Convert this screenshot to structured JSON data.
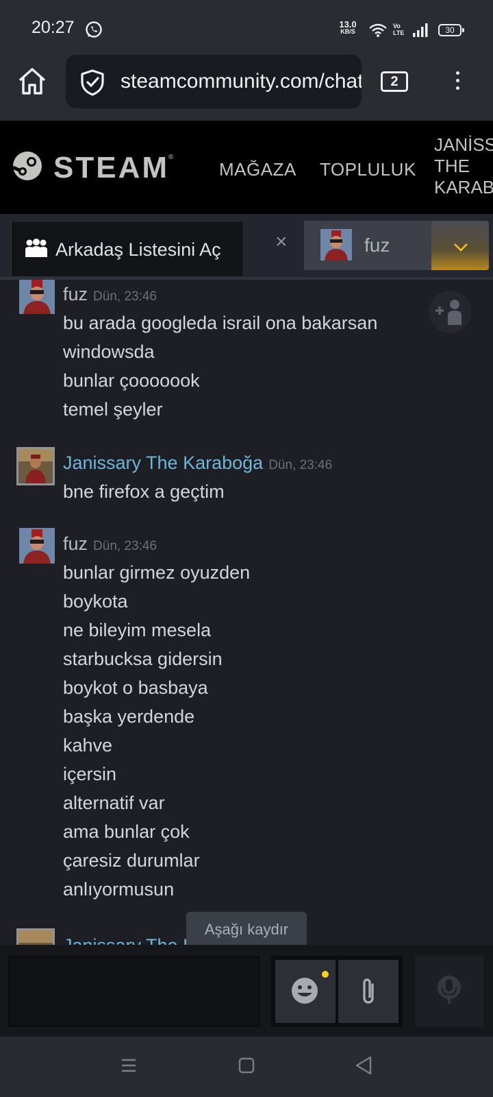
{
  "status_bar": {
    "time": "20:27",
    "net_speed_value": "13.0",
    "net_speed_unit": "KB/S",
    "volte_top": "Vo",
    "volte_bottom": "LTE",
    "battery": "30",
    "icons": [
      "whatsapp-icon",
      "wifi-icon",
      "signal-icon",
      "battery-icon"
    ]
  },
  "browser": {
    "url": "steamcommunity.com/chat",
    "tab_count": "2"
  },
  "steam_header": {
    "logo_text": "STEAM",
    "logo_reg": "®",
    "nav": {
      "store": "MAĞAZA",
      "community": "TOPLULUK",
      "user_line1": "JANİSS",
      "user_line2": "THE",
      "user_line3": "KARAB"
    }
  },
  "chat_tabs": {
    "friends_button": "Arkadaş Listesini Aç",
    "close_symbol": "×",
    "active_tab_name": "fuz",
    "accent_color": "#f4c21a"
  },
  "messages": {
    "group1": {
      "sender": "fuz",
      "timestamp": "Dün, 23:46",
      "lines": [
        "bu arada googleda israil ona bakarsan",
        "windowsda",
        "bunlar çooooook",
        "temel şeyler"
      ]
    },
    "group2": {
      "sender": "Janissary The Karaboğa",
      "timestamp": "Dün, 23:46",
      "lines": [
        "bne firefox a geçtim"
      ]
    },
    "group3": {
      "sender": "fuz",
      "timestamp": "Dün, 23:46",
      "lines": [
        "bunlar girmez oyuzden",
        "boykota",
        "ne bileyim mesela",
        "starbucksa gidersin",
        "boykot o basbaya",
        "başka yerdende",
        "kahve",
        "içersin",
        "alternatif var",
        "ama bunlar çok",
        "çaresiz durumlar",
        "anlıyormusun"
      ]
    },
    "partial_sender": "Janissary The Karaboğa"
  },
  "scroll_toast": "Aşağı kaydır",
  "composer": {
    "input_value": "",
    "icons": [
      "send-icon",
      "emoji-icon",
      "attach-icon",
      "microphone-icon"
    ]
  },
  "colors": {
    "name_fuz": "#b9bec4",
    "name_janissary": "#6cb7d9",
    "timestamp": "#6b7079",
    "chat_bg": "#1e1f24"
  }
}
